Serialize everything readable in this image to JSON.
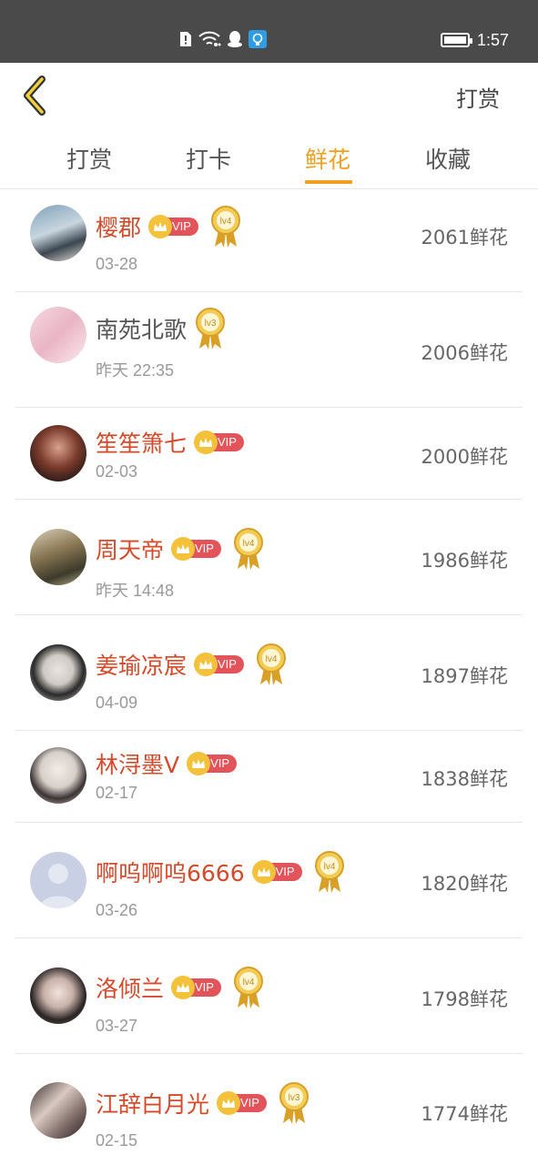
{
  "status_bar": {
    "time": "1:57",
    "icons": [
      "alert-icon",
      "wifi-icon",
      "qq-icon",
      "app-notification-icon",
      "battery-icon"
    ]
  },
  "header": {
    "back_icon": "chevron-left-icon",
    "action_label": "打赏"
  },
  "tabs": [
    {
      "label": "打赏",
      "active": false
    },
    {
      "label": "打卡",
      "active": false
    },
    {
      "label": "鲜花",
      "active": true
    },
    {
      "label": "收藏",
      "active": false
    }
  ],
  "colors": {
    "accent": "#f0a020",
    "vip_name": "#d44a2a",
    "vip_badge": "#e2545a",
    "status_bar": "#4a4a4a"
  },
  "vip_label": "VIP",
  "rows": [
    {
      "name": "樱郡",
      "vip": true,
      "level": "lv4",
      "date": "03-28",
      "count": "2061鲜花"
    },
    {
      "name": "南苑北歌",
      "vip": false,
      "level": "lv3",
      "date": "昨天 22:35",
      "count": "2006鲜花"
    },
    {
      "name": "笙笙箫七",
      "vip": true,
      "level": "",
      "date": "02-03",
      "count": "2000鲜花"
    },
    {
      "name": "周天帝",
      "vip": true,
      "level": "lv4",
      "date": "昨天 14:48",
      "count": "1986鲜花"
    },
    {
      "name": "姜瑜凉宸",
      "vip": true,
      "level": "lv4",
      "date": "04-09",
      "count": "1897鲜花"
    },
    {
      "name": "林浔墨V",
      "vip": true,
      "level": "",
      "date": "02-17",
      "count": "1838鲜花"
    },
    {
      "name": "啊呜啊呜6666",
      "vip": true,
      "level": "lv4",
      "date": "03-26",
      "count": "1820鲜花"
    },
    {
      "name": "洛倾兰",
      "vip": true,
      "level": "lv4",
      "date": "03-27",
      "count": "1798鲜花"
    },
    {
      "name": "江辞白月光",
      "vip": true,
      "level": "lv3",
      "date": "02-15",
      "count": "1774鲜花"
    }
  ]
}
